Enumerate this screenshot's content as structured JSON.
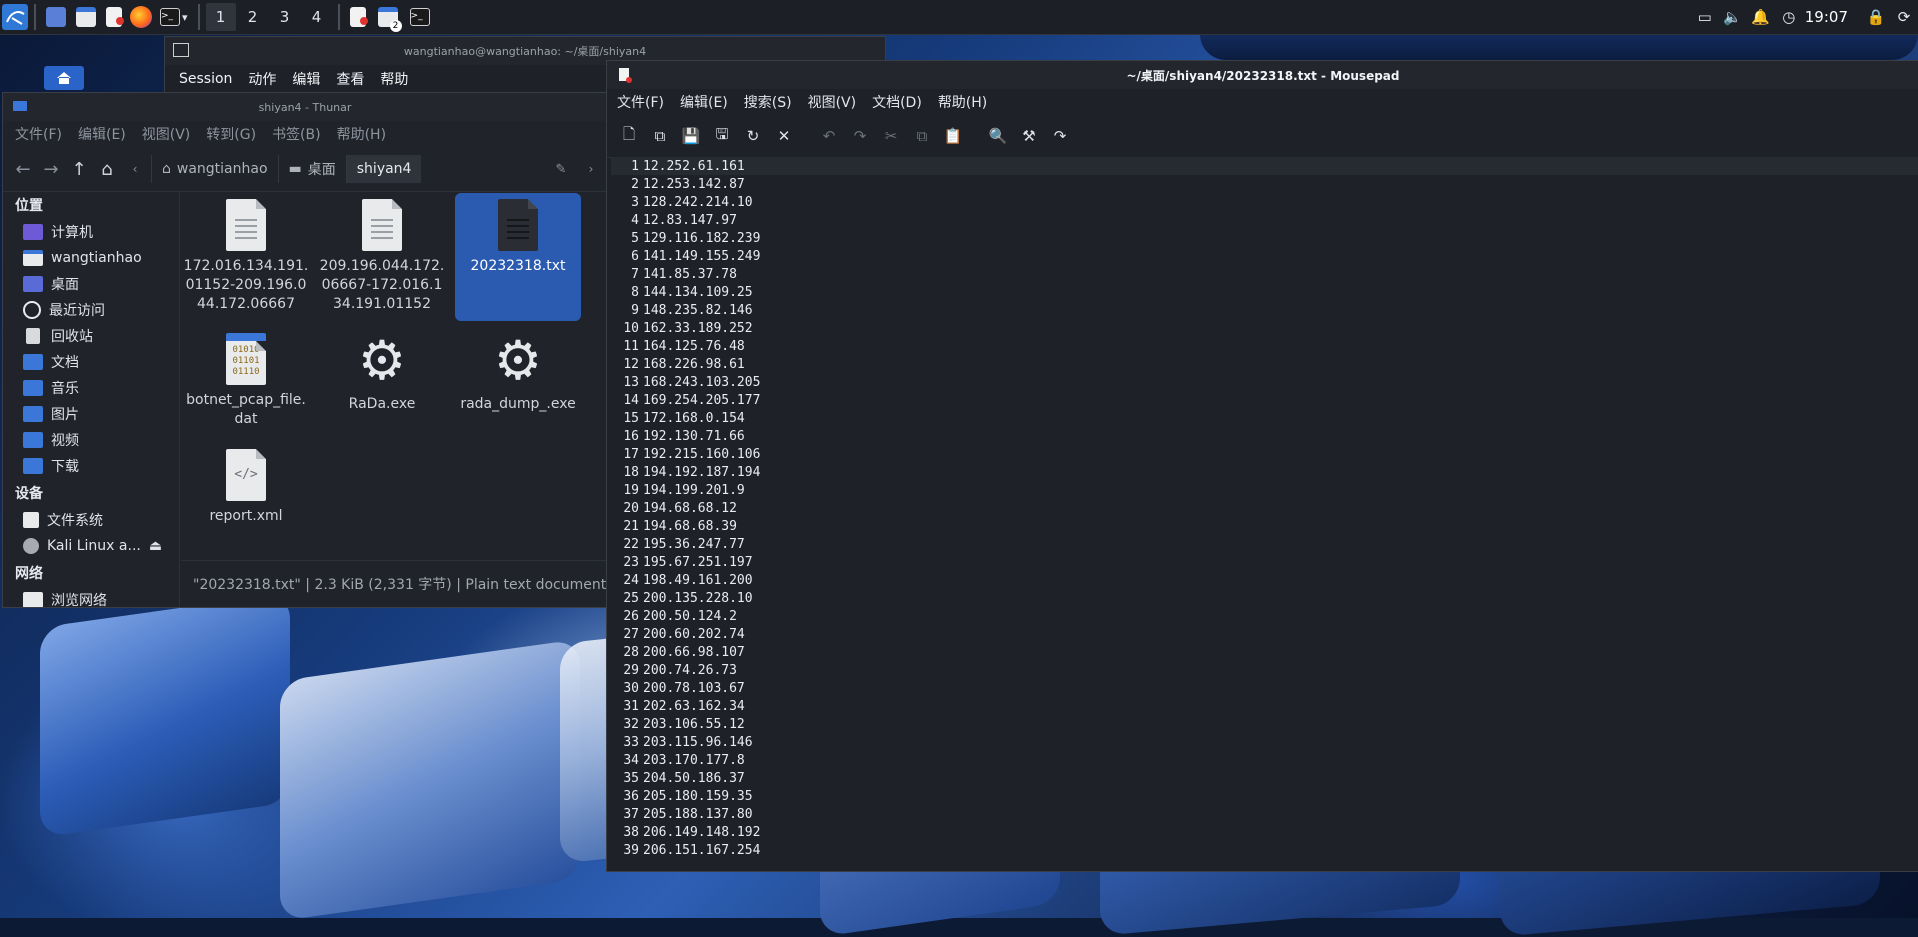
{
  "panel": {
    "workspaces": [
      "1",
      "2",
      "3",
      "4"
    ],
    "active_workspace": 0,
    "badge_count": "2",
    "clock": "19:07"
  },
  "terminal": {
    "title": "wangtianhao@wangtianhao: ~/桌面/shiyan4",
    "menu": [
      "Session",
      "动作",
      "编辑",
      "查看",
      "帮助"
    ]
  },
  "thunar": {
    "title": "shiyan4 - Thunar",
    "menu": [
      "文件(F)",
      "编辑(E)",
      "视图(V)",
      "转到(G)",
      "书签(B)",
      "帮助(H)"
    ],
    "breadcrumbs": [
      "wangtianhao",
      "桌面",
      "shiyan4"
    ],
    "sidebar": {
      "places_title": "位置",
      "places": [
        "计算机",
        "wangtianhao",
        "桌面",
        "最近访问",
        "回收站",
        "文档",
        "音乐",
        "图片",
        "视频",
        "下载"
      ],
      "devices_title": "设备",
      "devices": [
        "文件系统",
        "Kali Linux a..."
      ],
      "network_title": "网络",
      "network": [
        "浏览网络"
      ]
    },
    "files": [
      {
        "name": "172.016.134.191.01152-209.196.044.172.06667"
      },
      {
        "name": "209.196.044.172.06667-172.016.134.191.01152"
      },
      {
        "name": "20232318.txt"
      },
      {
        "name": "botnet_pcap_file.dat"
      },
      {
        "name": "RaDa.exe"
      },
      {
        "name": "rada_dump_.exe"
      },
      {
        "name": "report.xml"
      }
    ],
    "status": "\"20232318.txt\" | 2.3 KiB (2,331 字节) | Plain text document"
  },
  "mousepad": {
    "title": "~/桌面/shiyan4/20232318.txt - Mousepad",
    "menu": [
      "文件(F)",
      "编辑(E)",
      "搜索(S)",
      "视图(V)",
      "文档(D)",
      "帮助(H)"
    ],
    "lines": [
      "12.252.61.161",
      "12.253.142.87",
      "128.242.214.10",
      "12.83.147.97",
      "129.116.182.239",
      "141.149.155.249",
      "141.85.37.78",
      "144.134.109.25",
      "148.235.82.146",
      "162.33.189.252",
      "164.125.76.48",
      "168.226.98.61",
      "168.243.103.205",
      "169.254.205.177",
      "172.168.0.154",
      "192.130.71.66",
      "192.215.160.106",
      "194.192.187.194",
      "194.199.201.9",
      "194.68.68.12",
      "194.68.68.39",
      "195.36.247.77",
      "195.67.251.197",
      "198.49.161.200",
      "200.135.228.10",
      "200.50.124.2",
      "200.60.202.74",
      "200.66.98.107",
      "200.74.26.73",
      "200.78.103.67",
      "202.63.162.34",
      "203.106.55.12",
      "203.115.96.146",
      "203.170.177.8",
      "204.50.186.37",
      "205.180.159.35",
      "205.188.137.80",
      "206.149.148.192",
      "206.151.167.254"
    ]
  }
}
